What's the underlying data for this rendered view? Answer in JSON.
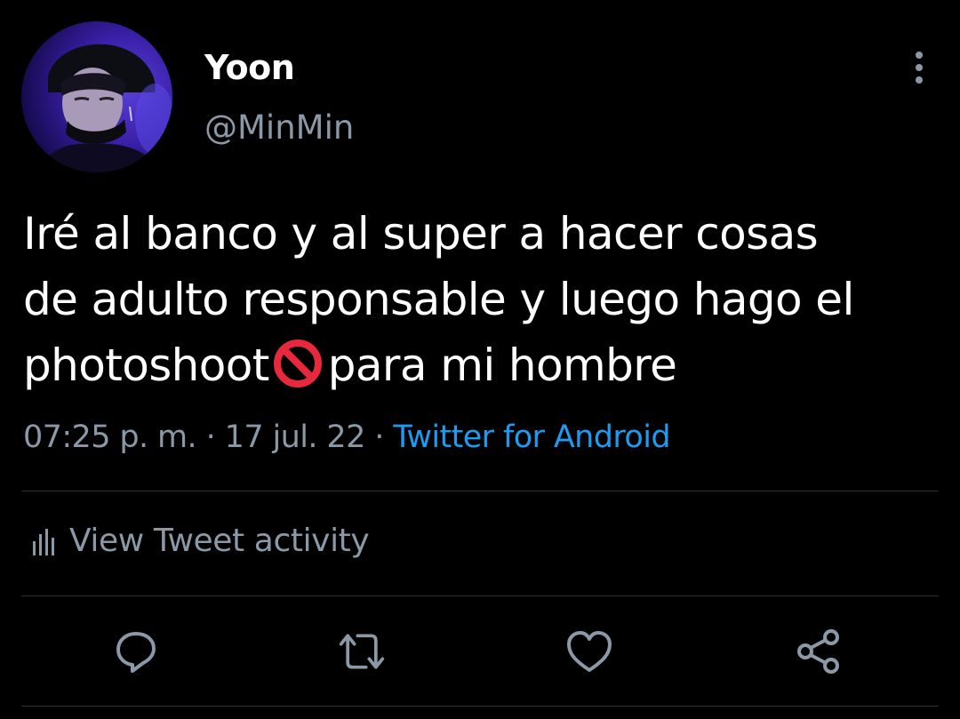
{
  "author": {
    "display_name": "Yoon",
    "handle": "@MinMin"
  },
  "tweet": {
    "text_line1": "Iré al banco y al super a hacer cosas",
    "text_line2": "de adulto responsable y luego hago el",
    "text_line3_before": "photoshoot",
    "text_line3_after": "para mi hombre",
    "emoji": "no-entry-sign-emoji"
  },
  "meta": {
    "time": "07:25 p. m.",
    "separator": "·",
    "date": "17 jul. 22",
    "source": "Twitter for Android"
  },
  "activity": {
    "label": "View Tweet activity",
    "icon": "bar-chart-icon"
  },
  "actions": {
    "reply_icon": "reply-icon",
    "retweet_icon": "retweet-icon",
    "like_icon": "heart-icon",
    "share_icon": "share-icon",
    "more_icon": "more-vertical-icon"
  },
  "colors": {
    "background": "#000000",
    "text": "#ffffff",
    "secondary": "#8b98a5",
    "link": "#1d9bf0",
    "divider": "#2f3336",
    "emoji_red": "#e8283c"
  }
}
